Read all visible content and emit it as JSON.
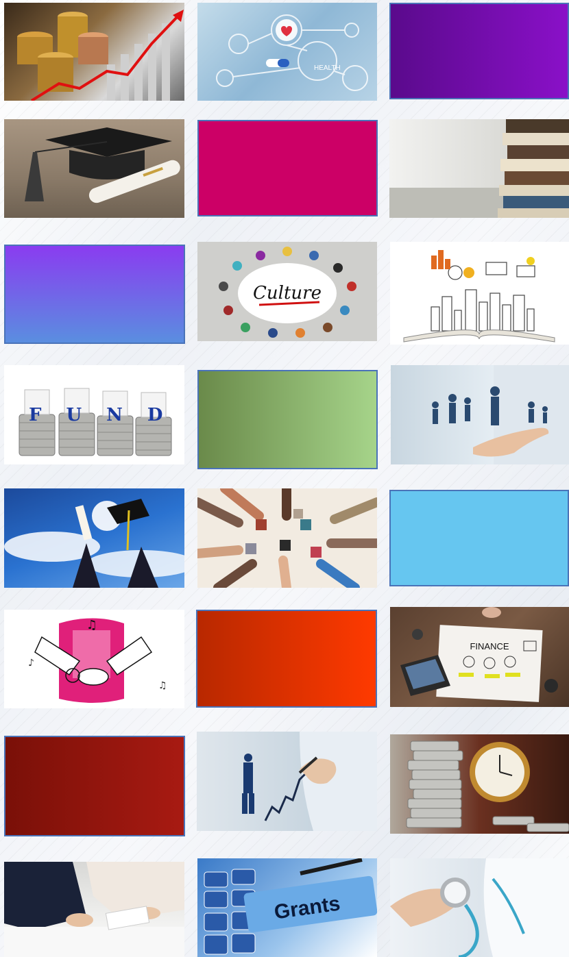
{
  "tiles": [
    {
      "id": "investment-growth",
      "caption": "",
      "label": ""
    },
    {
      "id": "health-tech",
      "caption": "",
      "label": "HEALTH"
    },
    {
      "id": "purple-panel",
      "caption": "",
      "label": ""
    },
    {
      "id": "graduation-cap",
      "caption": "",
      "label": ""
    },
    {
      "id": "magenta-panel",
      "caption": "",
      "label": ""
    },
    {
      "id": "books-stack",
      "caption": "",
      "label": ""
    },
    {
      "id": "violet-blue-panel",
      "caption": "",
      "label": ""
    },
    {
      "id": "culture-circle",
      "caption": "",
      "label": "Culture"
    },
    {
      "id": "open-book-city",
      "caption": "",
      "label": ""
    },
    {
      "id": "fund-coins",
      "caption": "",
      "label": "FUND"
    },
    {
      "id": "green-panel",
      "caption": "",
      "label": ""
    },
    {
      "id": "business-people-hand",
      "caption": "",
      "label": ""
    },
    {
      "id": "graduation-sky",
      "caption": "",
      "label": ""
    },
    {
      "id": "puzzle-hands",
      "caption": "",
      "label": ""
    },
    {
      "id": "sky-blue-panel",
      "caption": "",
      "label": ""
    },
    {
      "id": "music-partnership",
      "caption": "",
      "label": ""
    },
    {
      "id": "orange-red-panel",
      "caption": "",
      "label": ""
    },
    {
      "id": "finance-desk",
      "caption": "",
      "label": "FINANCE"
    },
    {
      "id": "dark-red-panel",
      "caption": "",
      "label": ""
    },
    {
      "id": "growth-drawing",
      "caption": "",
      "label": ""
    },
    {
      "id": "coins-clock",
      "caption": "",
      "label": ""
    },
    {
      "id": "business-meeting",
      "caption": "",
      "label": ""
    },
    {
      "id": "grants-calculator",
      "caption": "",
      "label": "Grants"
    },
    {
      "id": "doctor-stethoscope",
      "caption": "",
      "label": ""
    }
  ],
  "colors": {
    "purple": [
      "#5a0a8c",
      "#8a10c8"
    ],
    "magenta": "#cc0066",
    "violet_blue": [
      "#8a3cf0",
      "#5a8ee0"
    ],
    "green": [
      "#6a8a4a",
      "#a6d48a"
    ],
    "sky_blue": "#66c6f0",
    "orange_red": [
      "#b82800",
      "#ff3a00"
    ],
    "dark_red": [
      "#7a1008",
      "#a81a12"
    ],
    "tile_border": "#4a73b8"
  }
}
